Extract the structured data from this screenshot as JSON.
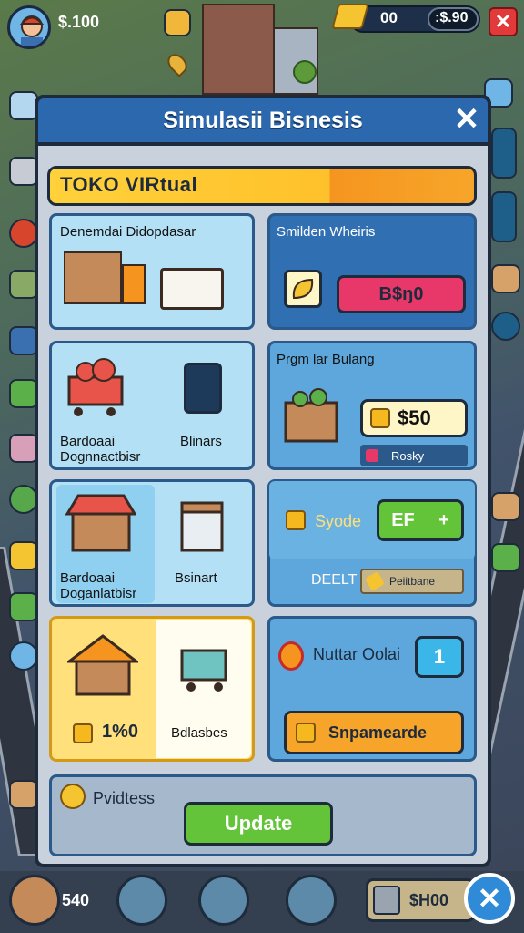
{
  "hud": {
    "money": "$.100",
    "gold_value": "00",
    "cash_value": ":$.90"
  },
  "modal": {
    "title": "Simulasii Bisnesis",
    "close": "✕",
    "banner": "TOKO VIRtual"
  },
  "cards": {
    "c1_title": "Denemdai Didopdasar",
    "c2_title": "Smilden Wheiris",
    "c2_button": "B$ŋ0",
    "c3_label_a": "Bardoaai\nDognnactbisr",
    "c3_label_b": "Blinars",
    "c4_title": "Prgm lar Bulang",
    "c4_price": "$50",
    "c4_tag": "Rosky",
    "c5_label_a": "Bardoaai\nDoganlatbisr",
    "c5_label_b": "Bsinart",
    "c6_label": "Syode",
    "c6_button": "EF",
    "c6_button_plus": "+",
    "c6_deelt": "DEELT",
    "c6_tag": "Peiitbane",
    "c7_value": "1%0",
    "c7_label": "Bdlasbes",
    "c8_label": "Nuttar Oolai",
    "c8_count": "1",
    "c8_button": "Snpamearde",
    "c9_label": "Pvidtess",
    "c9_button": "Update"
  },
  "bottom": {
    "count_left": "540",
    "count_right": "$H00"
  }
}
